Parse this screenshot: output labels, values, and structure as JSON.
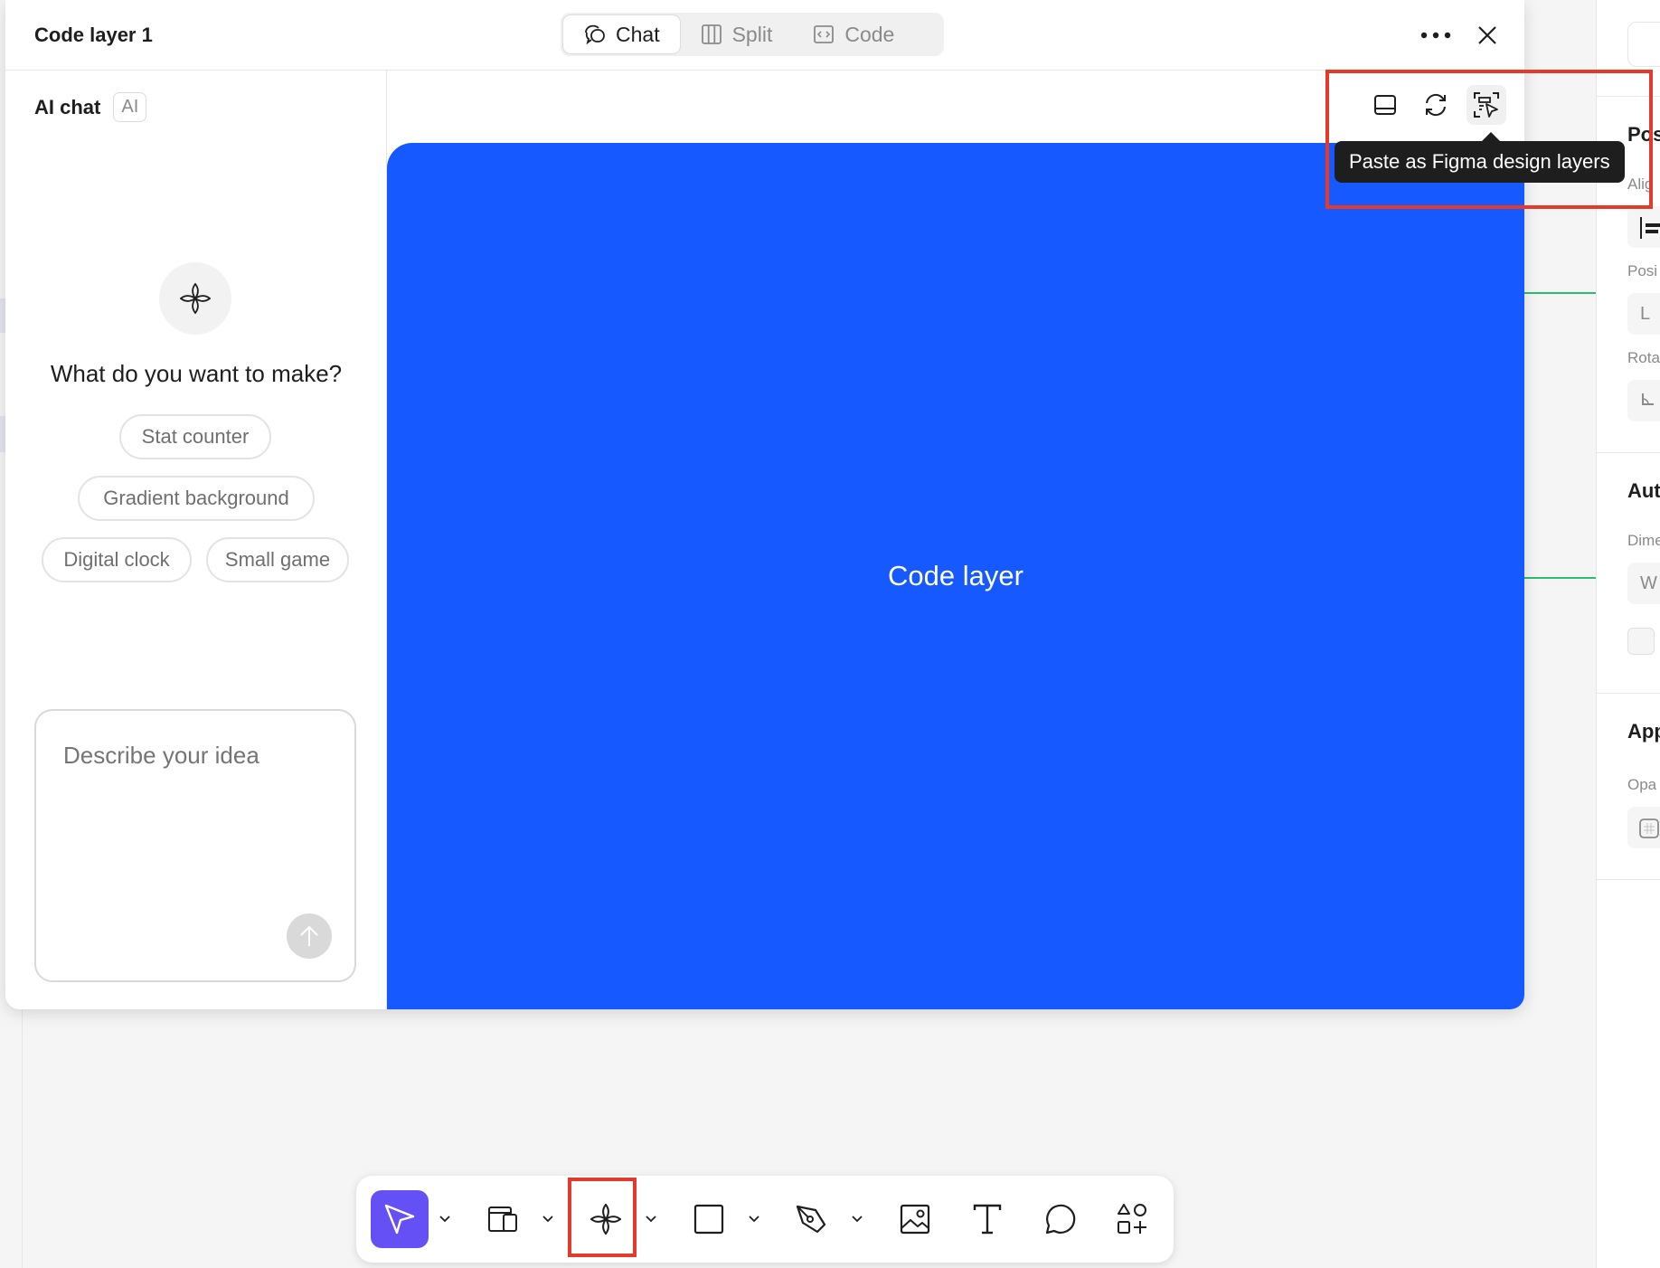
{
  "window": {
    "title": "Code layer 1",
    "view_tabs": [
      {
        "label": "Chat",
        "icon": "chat-icon",
        "active": true
      },
      {
        "label": "Split",
        "icon": "split-columns-icon",
        "active": false
      },
      {
        "label": "Code",
        "icon": "code-icon",
        "active": false
      }
    ]
  },
  "chat": {
    "title": "AI chat",
    "badge": "AI",
    "question": "What do you want to make?",
    "suggestions": [
      "Stat counter",
      "Gradient background",
      "Digital clock",
      "Small game"
    ],
    "input_placeholder": "Describe your idea"
  },
  "preview": {
    "layer_label": "Code layer",
    "layer_color": "#1559ff",
    "tooltip": "Paste as Figma design layers"
  },
  "props_panel": {
    "sections": [
      "Pos",
      "Aut",
      "App"
    ],
    "labels": [
      "Alig",
      "Posi",
      "Rota",
      "Dime",
      "Opa"
    ],
    "fields": [
      "L",
      "W"
    ]
  },
  "toolbar": {
    "tools": [
      "move-tool",
      "frame-tool",
      "ai-spark-tool",
      "rectangle-tool",
      "pen-tool",
      "image-tool",
      "text-tool",
      "comment-tool",
      "actions-tool"
    ],
    "active_color": "#6550f5"
  },
  "colors": {
    "annotation_red": "#e33a2c",
    "guide_green": "#2dbd6e"
  }
}
